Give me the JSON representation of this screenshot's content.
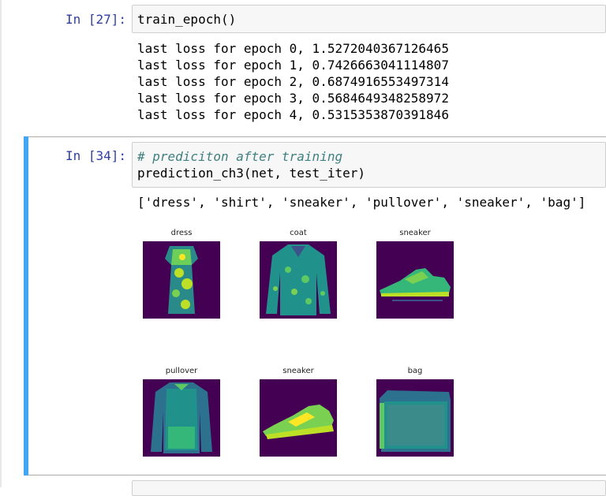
{
  "cells": [
    {
      "prompt": "In [27]:",
      "code": "train_epoch()",
      "output_lines": [
        "last loss for epoch 0, 1.5272040367126465",
        "last loss for epoch 1, 0.7426663041114807",
        "last loss for epoch 2, 0.6874916553497314",
        "last loss for epoch 3, 0.5684649348258972",
        "last loss for epoch 4, 0.5315353870391846"
      ]
    },
    {
      "prompt": "In [34]:",
      "comment": "# prediciton after training",
      "code": "prediction_ch3(net, test_iter)",
      "output_text": "['dress', 'shirt', 'sneaker', 'pullover', 'sneaker', 'bag']",
      "images": [
        {
          "title": "dress",
          "icon": "dress-image"
        },
        {
          "title": "coat",
          "icon": "coat-image"
        },
        {
          "title": "sneaker",
          "icon": "sneaker-image"
        },
        {
          "title": "pullover",
          "icon": "pullover-image"
        },
        {
          "title": "sneaker",
          "icon": "sneaker-image"
        },
        {
          "title": "bag",
          "icon": "bag-image"
        }
      ]
    }
  ],
  "colors": {
    "prompt": "#303f9f",
    "selected_bar": "#42a5f5",
    "image_background": "#440154",
    "comment": "#408080"
  }
}
